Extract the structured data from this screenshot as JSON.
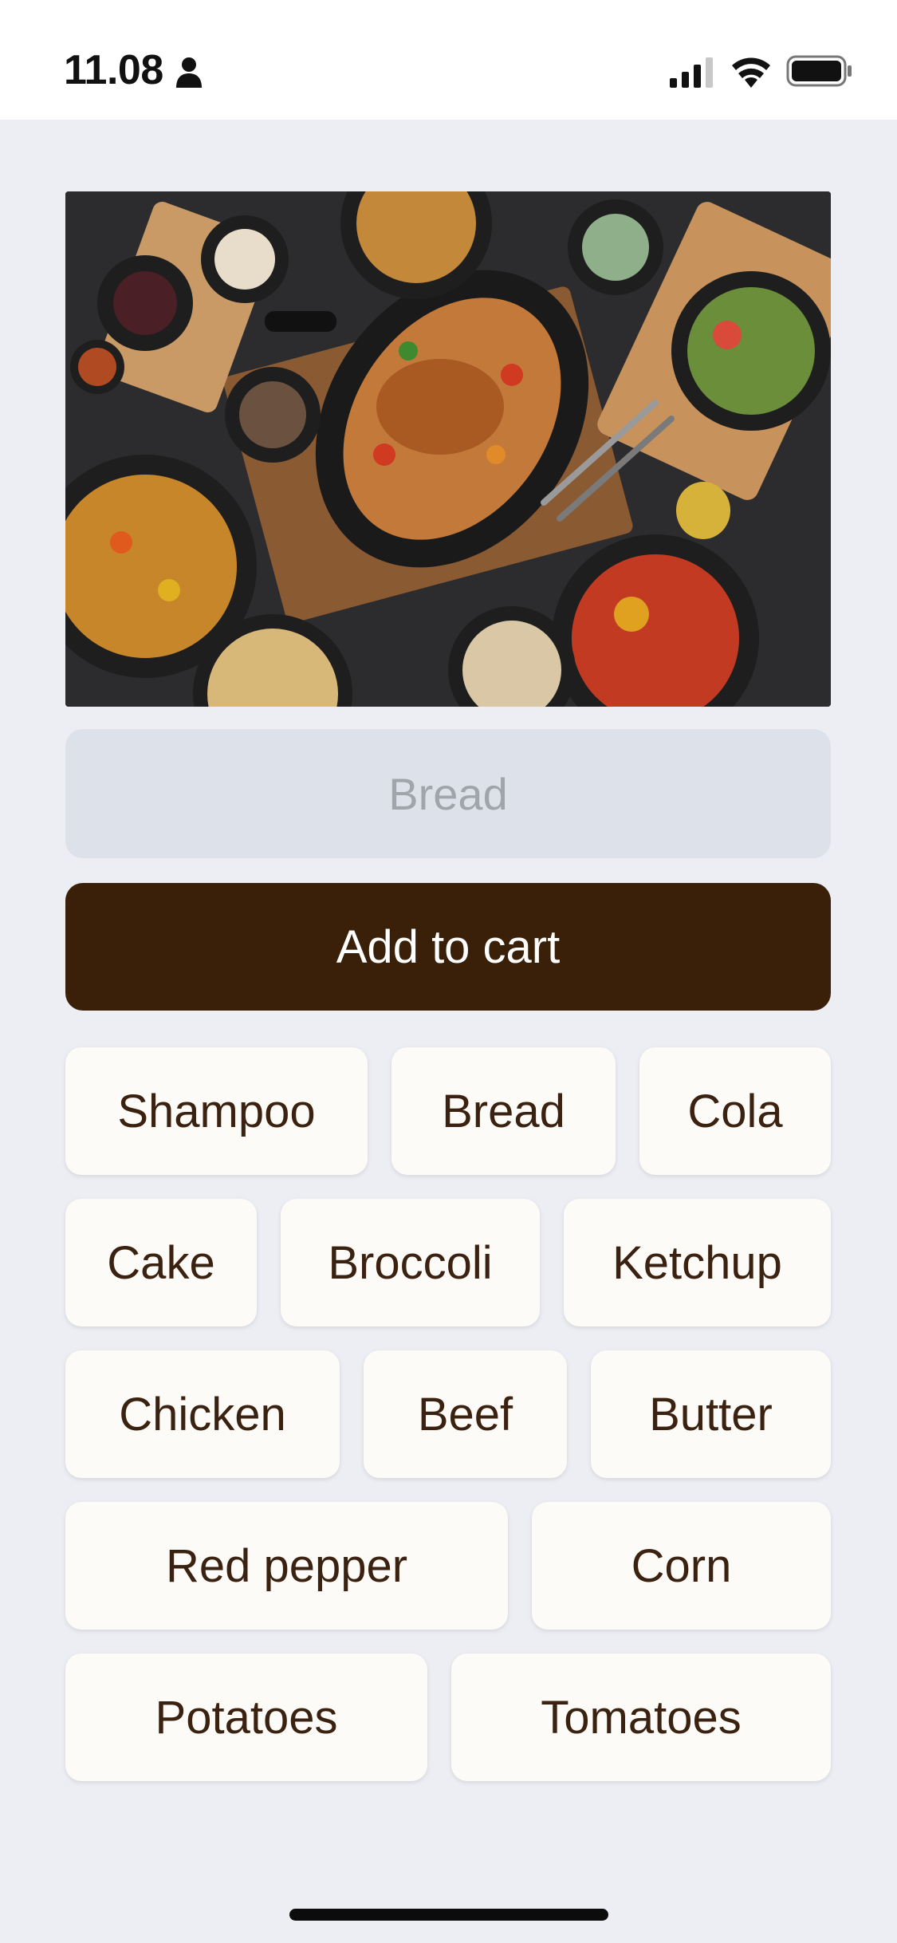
{
  "status_bar": {
    "time": "11.08",
    "icons": [
      "person-icon",
      "cellular-signal-icon",
      "wifi-icon",
      "battery-icon"
    ]
  },
  "hero": {
    "image": "food-table-photo"
  },
  "selected_item": {
    "value": "Bread"
  },
  "actions": {
    "add_to_cart_label": "Add to cart"
  },
  "chips": {
    "rows": [
      [
        "Shampoo",
        "Bread",
        "Cola"
      ],
      [
        "Cake",
        "Broccoli",
        "Ketchup"
      ],
      [
        "Chicken",
        "Beef",
        "Butter"
      ],
      [
        "Red pepper",
        "Corn"
      ],
      [
        "Potatoes",
        "Tomatoes"
      ]
    ]
  },
  "colors": {
    "background": "#eceef3",
    "primary_button": "#3b2009",
    "chip_background": "#fcfbf8",
    "chip_text": "#3a2110",
    "field_background": "#dde1ea",
    "field_text": "#a0a4ab"
  }
}
